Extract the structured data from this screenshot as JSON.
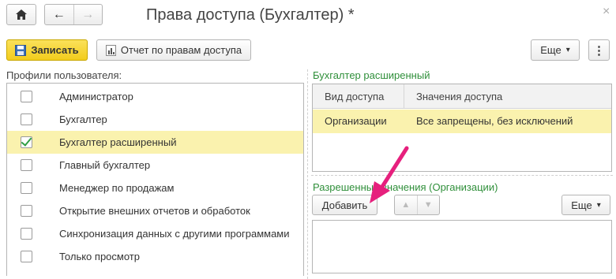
{
  "window": {
    "title": "Права доступа (Бухгалтер) *",
    "close_glyph": "×"
  },
  "toolbar": {
    "save_label": "Записать",
    "report_label": "Отчет по правам доступа",
    "more_label": "Еще",
    "more_arrow": "▾",
    "menu_glyph": "⋮"
  },
  "nav": {
    "back_glyph": "←",
    "forward_glyph": "→"
  },
  "profiles": {
    "label": "Профили пользователя:",
    "items": [
      {
        "label": "Администратор",
        "checked": false
      },
      {
        "label": "Бухгалтер",
        "checked": false
      },
      {
        "label": "Бухгалтер расширенный",
        "checked": true
      },
      {
        "label": "Главный бухгалтер",
        "checked": false
      },
      {
        "label": "Менеджер по продажам",
        "checked": false
      },
      {
        "label": "Открытие внешних отчетов и обработок",
        "checked": false
      },
      {
        "label": "Синхронизация данных с другими программами",
        "checked": false
      },
      {
        "label": "Только просмотр",
        "checked": false
      }
    ]
  },
  "access": {
    "group_label": "Бухгалтер расширенный",
    "columns": [
      "Вид доступа",
      "Значения доступа"
    ],
    "rows": [
      {
        "kind": "Организации",
        "values": "Все запрещены, без исключений"
      }
    ]
  },
  "allowed": {
    "label": "Разрешенные значения (Организации)",
    "add_label": "Добавить",
    "up_glyph": "▲",
    "down_glyph": "▼",
    "more_label": "Еще",
    "more_arrow": "▾"
  },
  "colors": {
    "accent_green": "#2f8f3a",
    "save_yellow": "#f5d32a",
    "selection": "#faf2ae",
    "annotation_arrow": "#e6207d"
  },
  "icons": {
    "home": "home-icon",
    "save": "floppy-disk-icon",
    "report": "report-icon"
  }
}
